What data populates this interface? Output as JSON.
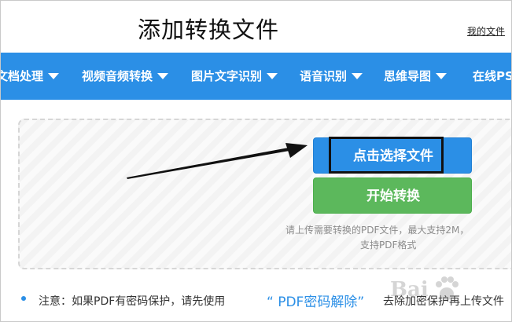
{
  "header": {
    "title": "添加转换文件",
    "my_files_link": "我的文件"
  },
  "nav": {
    "items": [
      {
        "label": "文档处理",
        "has_caret": true
      },
      {
        "label": "视频音频转换",
        "has_caret": true
      },
      {
        "label": "图片文字识别",
        "has_caret": true
      },
      {
        "label": "语音识别",
        "has_caret": true
      },
      {
        "label": "思维导图",
        "has_caret": true
      },
      {
        "label": "在线PS",
        "has_caret": false
      }
    ],
    "background": "#2b8fe6",
    "text_color": "#ffffff"
  },
  "upload": {
    "select_label": "点击选择文件",
    "start_label": "开始转换",
    "hint_line_1": "请上传需要转换的PDF文件，最大支持2M，",
    "hint_line_2": "支持PDF格式",
    "select_color": "#2b8fe6",
    "start_color": "#5cb85c"
  },
  "notice": {
    "text": "注意：如果PDF有密码保护，请先使用",
    "link": "“ PDF密码解除”",
    "tail": "去除加密保护再上传文件"
  },
  "watermark": {
    "text": "Bai"
  }
}
